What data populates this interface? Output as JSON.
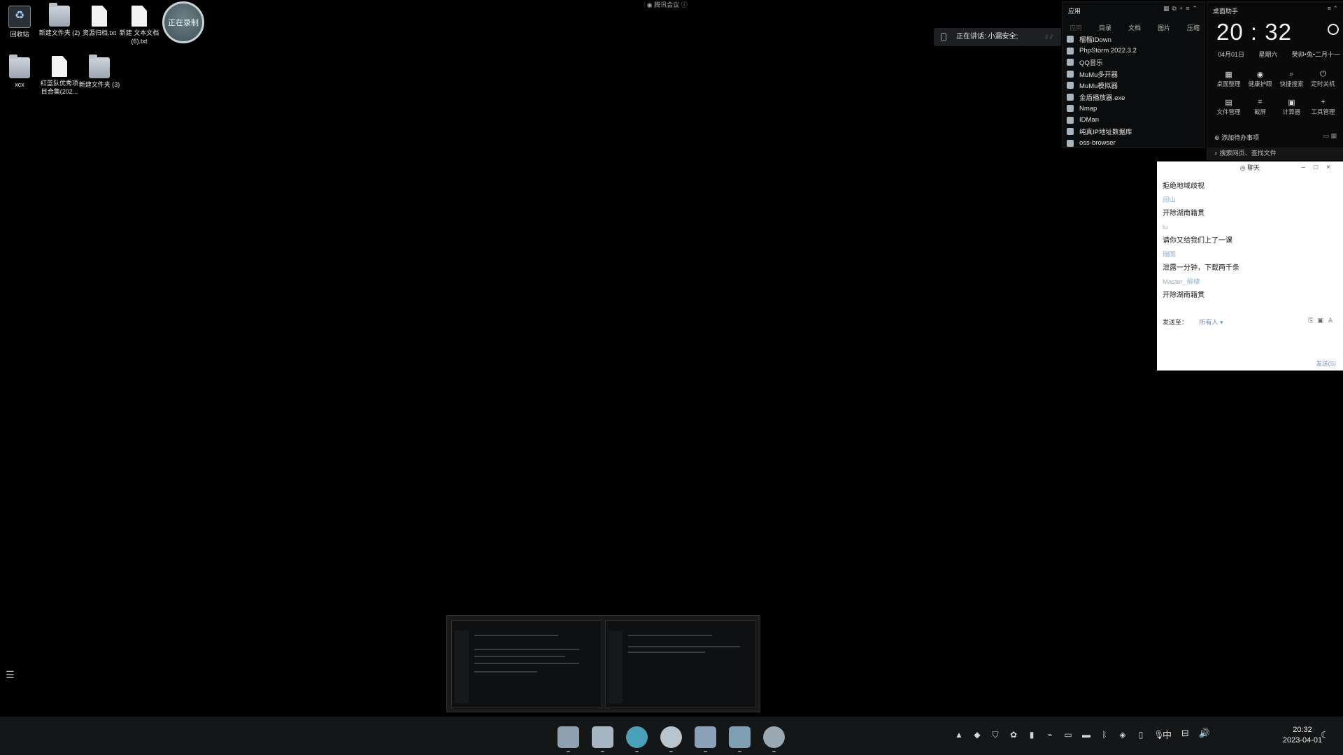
{
  "desktop": {
    "icons": [
      {
        "label": "回收站"
      },
      {
        "label": "新建文件夹 (2)"
      },
      {
        "label": "资源归档.txt"
      },
      {
        "label": "新建 文本文档 (6).txt"
      },
      {
        "label": "xcx"
      },
      {
        "label": "红蓝队优秀项目合集(202..."
      },
      {
        "label": "新建文件夹 (3)"
      }
    ],
    "badge_label": "正在录制"
  },
  "meeting": {
    "app_title": "腾讯会议",
    "speaking_text": "正在讲话: 小漏安全;"
  },
  "apps_panel": {
    "title": "应用",
    "tabs": [
      "应用",
      "目录",
      "文档",
      "图片",
      "压缩"
    ],
    "items": [
      {
        "label": "榴榴IDown"
      },
      {
        "label": "PhpStorm 2022.3.2"
      },
      {
        "label": "QQ音乐"
      },
      {
        "label": "MuMu多开器"
      },
      {
        "label": "MuMu模拟器"
      },
      {
        "label": "金盾播放器.exe"
      },
      {
        "label": "Nmap"
      },
      {
        "label": "IDMan"
      },
      {
        "label": "纯真IP地址数据库"
      },
      {
        "label": "oss-browser"
      }
    ]
  },
  "clock_widget": {
    "title": "桌面助手",
    "time": "20 : 32",
    "date": "04月01日",
    "weekday": "星期六",
    "lunar": "癸卯•兔•二月十一",
    "tools": [
      {
        "label": "桌面整理",
        "icon": "grid-icon"
      },
      {
        "label": "健康护眼",
        "icon": "eye-icon"
      },
      {
        "label": "快捷搜索",
        "icon": "search-icon"
      },
      {
        "label": "定时关机",
        "icon": "power-icon"
      },
      {
        "label": "文件管理",
        "icon": "folder-icon"
      },
      {
        "label": "截屏",
        "icon": "crop-icon"
      },
      {
        "label": "计算器",
        "icon": "calculator-icon"
      },
      {
        "label": "工具管理",
        "icon": "plus-icon"
      }
    ],
    "todo_label": "添加待办事项",
    "search_label": "搜索网页、查找文件"
  },
  "chat": {
    "title": "聊天",
    "messages": [
      {
        "kind": "text",
        "value": "拒绝地域歧视"
      },
      {
        "kind": "name",
        "value": "阎山"
      },
      {
        "kind": "text",
        "value": "开除湖南籍贯"
      },
      {
        "kind": "name",
        "value": "lu"
      },
      {
        "kind": "text",
        "value": "请你又给我们上了一课"
      },
      {
        "kind": "name",
        "value": "瑞图"
      },
      {
        "kind": "text",
        "value": "泄露一分钟，下载两千条"
      },
      {
        "kind": "name",
        "value": "Master_柳棣"
      },
      {
        "kind": "text",
        "value": "开除湖南籍贯"
      }
    ],
    "send_to_label": "发送至：",
    "send_to_value": "所有人 ▾",
    "send_label": "发送(S)"
  },
  "taskbar": {
    "apps": [
      {
        "name": "start",
        "color": "#8fa0b0"
      },
      {
        "name": "file-explorer",
        "color": "#a8b6c4"
      },
      {
        "name": "edge",
        "color": "#4aa0b8"
      },
      {
        "name": "chrome",
        "color": "#b9c4cc"
      },
      {
        "name": "tencent-meeting",
        "color": "#8aa2b8"
      },
      {
        "name": "monitor",
        "color": "#7fa0b4"
      },
      {
        "name": "steam",
        "color": "#9aa8b4"
      }
    ],
    "ime": "中",
    "clock_time": "20:32",
    "clock_date": "2023-04-01"
  }
}
